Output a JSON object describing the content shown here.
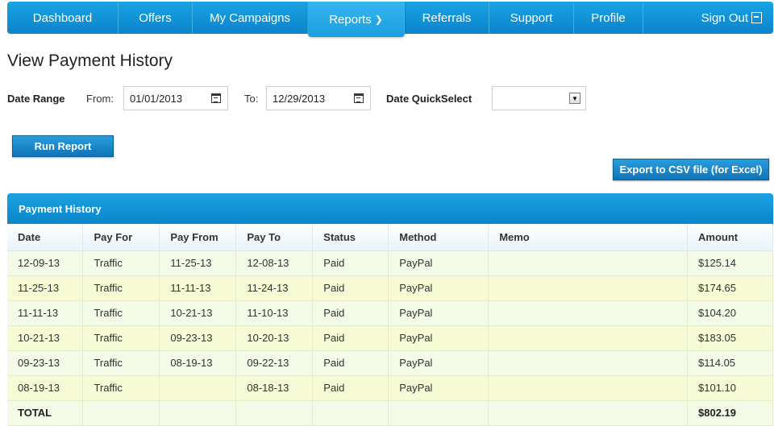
{
  "nav": {
    "items": [
      {
        "label": "Dashboard"
      },
      {
        "label": "Offers"
      },
      {
        "label": "My Campaigns"
      },
      {
        "label": "Reports"
      },
      {
        "label": "Referrals"
      },
      {
        "label": "Support"
      },
      {
        "label": "Profile"
      },
      {
        "label": "Sign Out"
      }
    ]
  },
  "page": {
    "title": "View Payment History"
  },
  "filters": {
    "date_range_label": "Date Range",
    "from_label": "From:",
    "from_value": "01/01/2013",
    "to_label": "To:",
    "to_value": "12/29/2013",
    "quickselect_label": "Date QuickSelect",
    "quickselect_value": ""
  },
  "buttons": {
    "run_report": "Run Report",
    "export_csv": "Export to CSV file (for Excel)"
  },
  "table": {
    "title": "Payment History",
    "columns": [
      "Date",
      "Pay For",
      "Pay From",
      "Pay To",
      "Status",
      "Method",
      "Memo",
      "Amount"
    ],
    "rows": [
      [
        "12-09-13",
        "Traffic",
        "11-25-13",
        "12-08-13",
        "Paid",
        "PayPal",
        "",
        "$125.14"
      ],
      [
        "11-25-13",
        "Traffic",
        "11-11-13",
        "11-24-13",
        "Paid",
        "PayPal",
        "",
        "$174.65"
      ],
      [
        "11-11-13",
        "Traffic",
        "10-21-13",
        "11-10-13",
        "Paid",
        "PayPal",
        "",
        "$104.20"
      ],
      [
        "10-21-13",
        "Traffic",
        "09-23-13",
        "10-20-13",
        "Paid",
        "PayPal",
        "",
        "$183.05"
      ],
      [
        "09-23-13",
        "Traffic",
        "08-19-13",
        "09-22-13",
        "Paid",
        "PayPal",
        "",
        "$114.05"
      ],
      [
        "08-19-13",
        "Traffic",
        "",
        "08-18-13",
        "Paid",
        "PayPal",
        "",
        "$101.10"
      ]
    ],
    "total_label": "TOTAL",
    "total_value": "$802.19"
  }
}
